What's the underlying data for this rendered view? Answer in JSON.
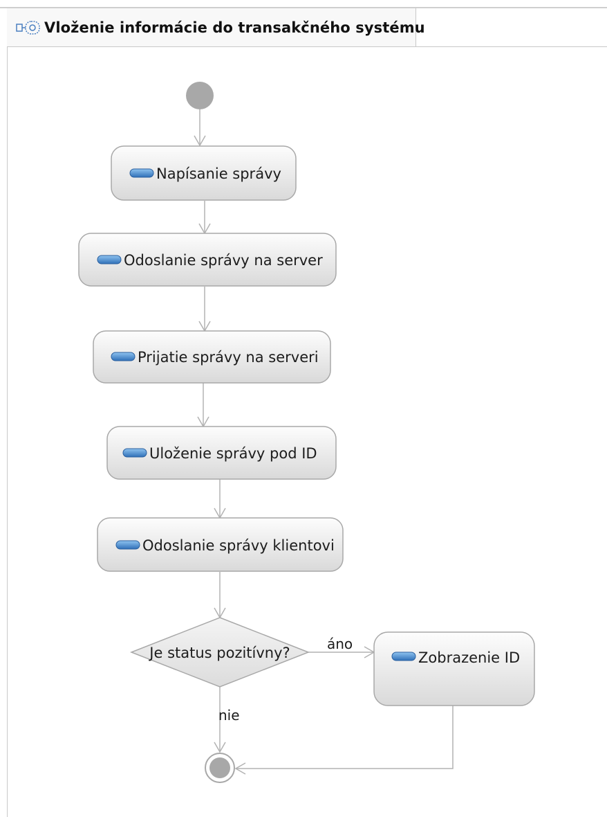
{
  "diagram": {
    "title": "Vloženie informácie do transakčného systému",
    "icon": "activity-diagram-icon",
    "actions": [
      {
        "id": "a1",
        "label": "Napísanie správy"
      },
      {
        "id": "a2",
        "label": "Odoslanie správy na server"
      },
      {
        "id": "a3",
        "label": "Prijatie správy na serveri"
      },
      {
        "id": "a4",
        "label": "Uloženie správy pod ID"
      },
      {
        "id": "a5",
        "label": "Odoslanie správy klientovi"
      },
      {
        "id": "a6",
        "label": "Zobrazenie ID"
      }
    ],
    "decision": {
      "label": "Je status pozitívny?"
    },
    "edge_labels": {
      "yes": "áno",
      "no": "nie"
    },
    "colors": {
      "node_fill_top": "#fdfdfd",
      "node_fill_bottom": "#dcdcdc",
      "node_stroke": "#a8a8a8",
      "edge": "#b0b0b0",
      "initial": "#a7a7a7",
      "action_icon": "#3c7fc4"
    }
  }
}
